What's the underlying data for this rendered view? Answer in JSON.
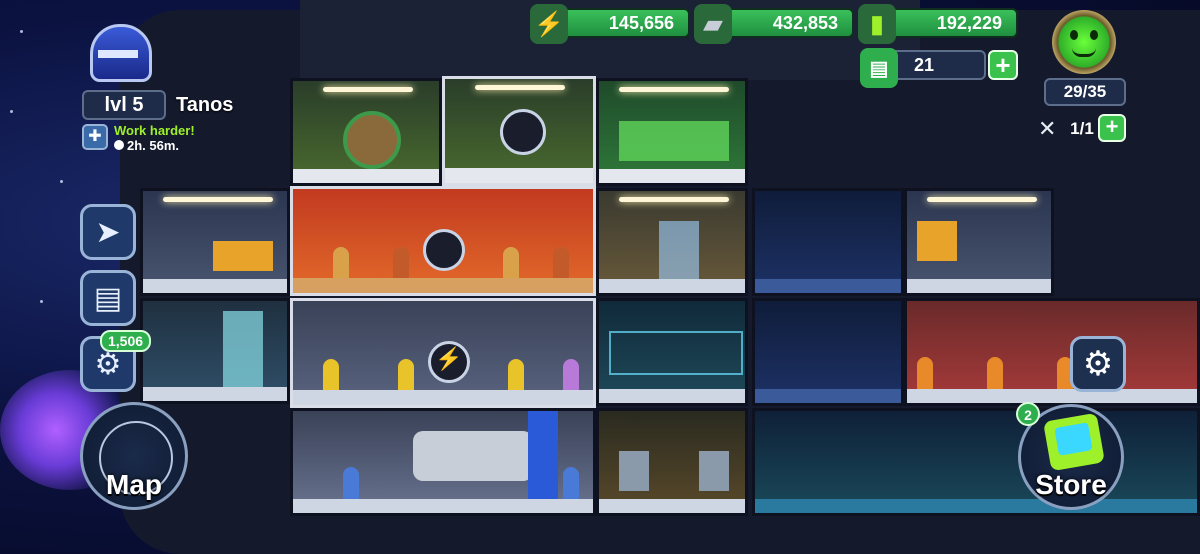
{
  "player": {
    "level_label": "lvl 5",
    "name": "Tanos",
    "task_text": "Work harder!",
    "task_timer": "2h. 56m."
  },
  "resources": {
    "energy": "145,656",
    "metal": "432,853",
    "fuel": "192,229",
    "premium": "21"
  },
  "crew": {
    "count": "29/35",
    "slots": "1/1"
  },
  "sidebar": {
    "badge_count": "1,506"
  },
  "buttons": {
    "map_label": "Map",
    "store_label": "Store",
    "store_badge": "2"
  },
  "colors": {
    "resource_green": "#2fae4d",
    "panel_dark": "#1e2c4a",
    "accent_lime": "#9ef02a",
    "badge_green": "#3bc24d"
  }
}
